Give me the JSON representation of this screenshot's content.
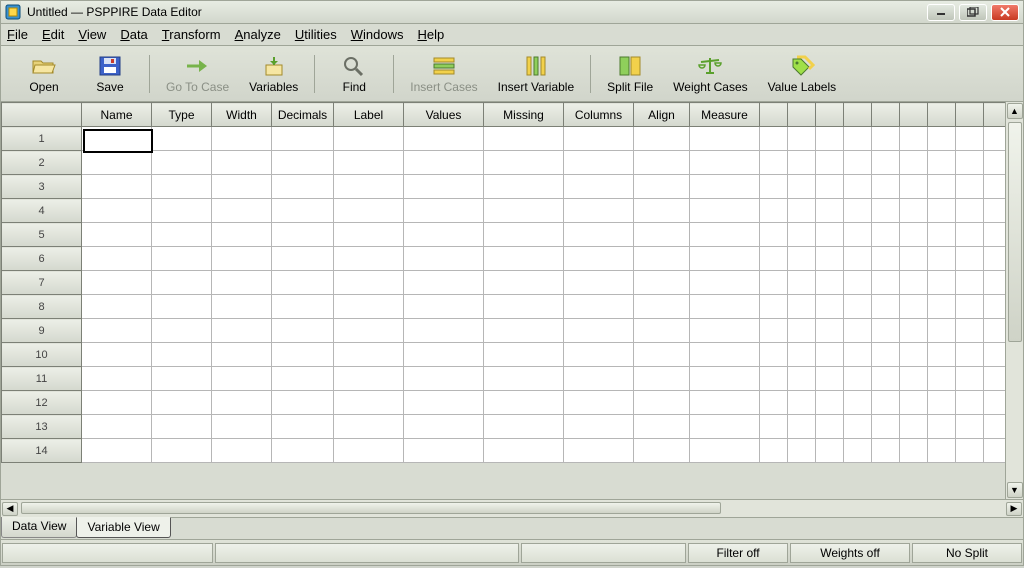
{
  "window": {
    "title": "Untitled — PSPPIRE Data Editor"
  },
  "menu": {
    "items": [
      {
        "letter": "F",
        "rest": "ile"
      },
      {
        "letter": "E",
        "rest": "dit"
      },
      {
        "letter": "V",
        "rest": "iew"
      },
      {
        "letter": "D",
        "rest": "ata"
      },
      {
        "letter": "T",
        "rest": "ransform"
      },
      {
        "letter": "A",
        "rest": "nalyze"
      },
      {
        "letter": "U",
        "rest": "tilities"
      },
      {
        "letter": "W",
        "rest": "indows"
      },
      {
        "letter": "H",
        "rest": "elp"
      }
    ]
  },
  "toolbar": {
    "open": "Open",
    "save": "Save",
    "gotocase": "Go To Case",
    "variables": "Variables",
    "find": "Find",
    "insertcases": "Insert Cases",
    "insertvariable": "Insert Variable",
    "splitfile": "Split File",
    "weightcases": "Weight Cases",
    "valuelabels": "Value Labels"
  },
  "columns": [
    "Name",
    "Type",
    "Width",
    "Decimals",
    "Label",
    "Values",
    "Missing",
    "Columns",
    "Align",
    "Measure"
  ],
  "rows": [
    "1",
    "2",
    "3",
    "4",
    "5",
    "6",
    "7",
    "8",
    "9",
    "10",
    "11",
    "12",
    "13",
    "14"
  ],
  "extra_cols": 11,
  "tabs": {
    "data": "Data View",
    "variable": "Variable View",
    "active": "variable"
  },
  "status": {
    "filter": "Filter off",
    "weights": "Weights off",
    "split": "No Split"
  }
}
